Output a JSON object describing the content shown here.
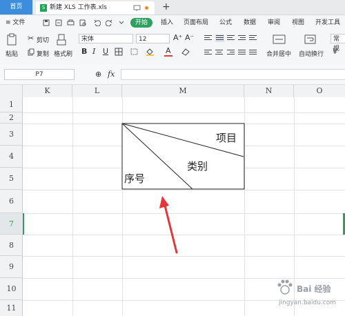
{
  "tabs": {
    "home": "首页",
    "doc_icon": "S",
    "doc_name": "新建 XLS 工作表.xls",
    "add": "+"
  },
  "menu": {
    "file": "≡ 文件",
    "items": [
      "开始",
      "插入",
      "页面布局",
      "公式",
      "数据",
      "审阅",
      "视图",
      "开发工具"
    ]
  },
  "ribbon": {
    "paste": "粘贴",
    "cut": "剪切",
    "copy": "复制",
    "format_painter": "格式刷",
    "font_name": "宋体",
    "font_size": "12",
    "bold": "B",
    "italic": "I",
    "underline": "U",
    "font_color_letter": "A",
    "grow_font": "A⁺",
    "shrink_font": "A⁻",
    "merge_center": "合并居中",
    "auto_wrap": "自动换行",
    "number_format": "常规",
    "currency": "¥"
  },
  "formula_bar": {
    "name_box": "P7",
    "fx": "fx",
    "zoom_icon_glyph": "⊕"
  },
  "columns": [
    "K",
    "L",
    "M",
    "N",
    "O"
  ],
  "rows": [
    "1",
    "2",
    "3",
    "4",
    "5",
    "6",
    "7",
    "8",
    "9",
    "10",
    "11"
  ],
  "active_row": "7",
  "header_cell": {
    "top_right": "项目",
    "middle": "类别",
    "bottom_left": "序号"
  },
  "colors": {
    "accent_green": "#2ea05f",
    "home_tab": "#3c8dde",
    "arrow_red": "#e5363a",
    "selection": "#2e9e5a"
  },
  "watermark": {
    "text": "Bai 经验",
    "sub": "jingyan.baidu.com"
  }
}
